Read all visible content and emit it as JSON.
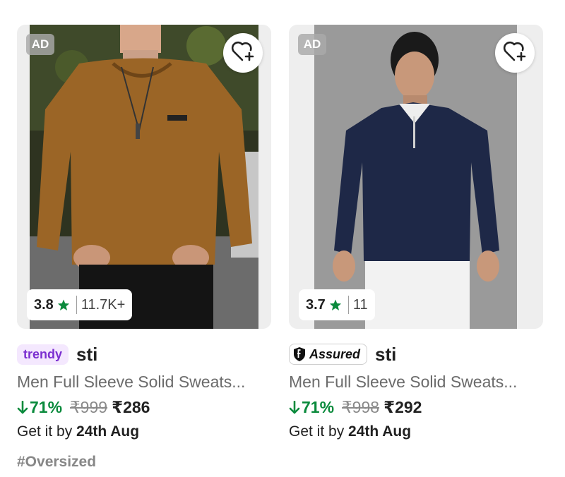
{
  "colors": {
    "discount_green": "#0a8a3c",
    "star_green": "#0a8a3c",
    "trendy_purple": "#7b2fd0",
    "trendy_bg": "#f4e8fe"
  },
  "products": [
    {
      "ad_label": "AD",
      "wishlist_icon": "heart-plus-icon",
      "rating": "3.8",
      "rating_icon": "star-icon",
      "rating_count": "11.7K+",
      "tag": "trendy",
      "brand": "sti",
      "title": "Men Full Sleeve Solid Sweats...",
      "discount": "71%",
      "mrp": "₹999",
      "price": "₹286",
      "delivery_prefix": "Get it by",
      "delivery_date": "24th Aug",
      "hashtag": "#Oversized"
    },
    {
      "ad_label": "AD",
      "wishlist_icon": "heart-plus-icon",
      "rating": "3.7",
      "rating_icon": "star-icon",
      "rating_count": "11",
      "tag": "Assured",
      "brand": "sti",
      "title": "Men Full Sleeve Solid Sweats...",
      "discount": "71%",
      "mrp": "₹998",
      "price": "₹292",
      "delivery_prefix": "Get it by",
      "delivery_date": "24th Aug"
    }
  ]
}
